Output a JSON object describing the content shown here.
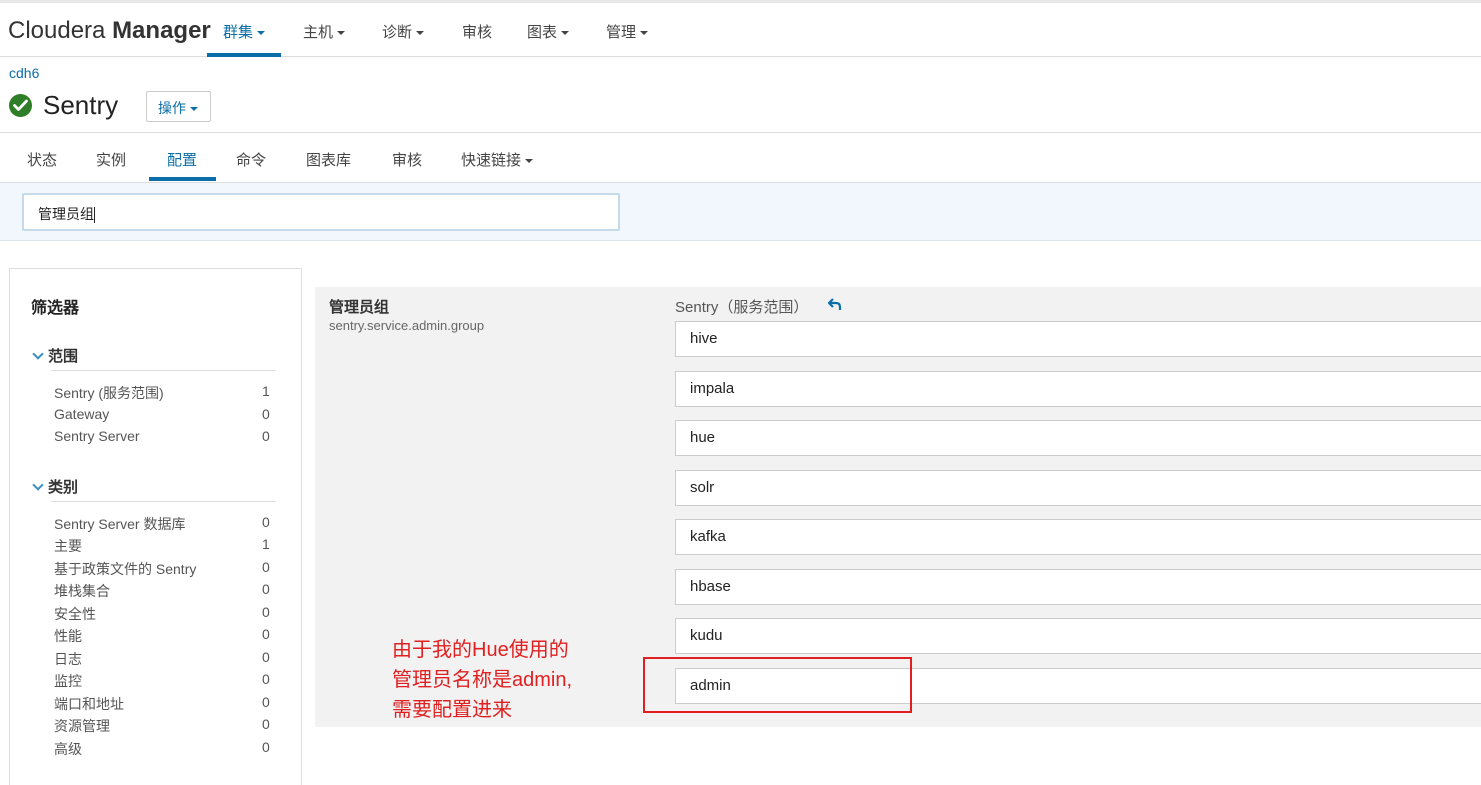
{
  "topnav": {
    "brand_light": "Cloudera ",
    "brand_bold": "Manager",
    "items": [
      {
        "label": "群集",
        "dropdown": true,
        "active": true
      },
      {
        "label": "主机",
        "dropdown": true
      },
      {
        "label": "诊断",
        "dropdown": true
      },
      {
        "label": "审核",
        "dropdown": false
      },
      {
        "label": "图表",
        "dropdown": true
      },
      {
        "label": "管理",
        "dropdown": true
      }
    ]
  },
  "header": {
    "breadcrumb": "cdh6",
    "service_name": "Sentry",
    "status": "good",
    "actions_label": "操作"
  },
  "tabs": [
    {
      "label": "状态"
    },
    {
      "label": "实例"
    },
    {
      "label": "配置",
      "active": true
    },
    {
      "label": "命令"
    },
    {
      "label": "图表库"
    },
    {
      "label": "审核"
    },
    {
      "label": "快速链接",
      "dropdown": true
    }
  ],
  "search": {
    "value": "管理员组"
  },
  "filter": {
    "title": "筛选器",
    "sections": [
      {
        "title": "范围",
        "items": [
          {
            "label": "Sentry (服务范围)",
            "count": "1"
          },
          {
            "label": "Gateway",
            "count": "0"
          },
          {
            "label": "Sentry Server",
            "count": "0"
          }
        ]
      },
      {
        "title": "类别",
        "items": [
          {
            "label": "Sentry Server 数据库",
            "count": "0"
          },
          {
            "label": "主要",
            "count": "1"
          },
          {
            "label": "基于政策文件的 Sentry",
            "count": "0"
          },
          {
            "label": "堆栈集合",
            "count": "0"
          },
          {
            "label": "安全性",
            "count": "0"
          },
          {
            "label": "性能",
            "count": "0"
          },
          {
            "label": "日志",
            "count": "0"
          },
          {
            "label": "监控",
            "count": "0"
          },
          {
            "label": "端口和地址",
            "count": "0"
          },
          {
            "label": "资源管理",
            "count": "0"
          },
          {
            "label": "高级",
            "count": "0"
          }
        ]
      }
    ]
  },
  "config": {
    "name": "管理员组",
    "key": "sentry.service.admin.group",
    "scope": "Sentry（服务范围）",
    "values": [
      "hive",
      "impala",
      "hue",
      "solr",
      "kafka",
      "hbase",
      "kudu",
      "admin"
    ]
  },
  "annotation": {
    "lines": [
      "由于我的Hue使用的",
      "管理员名称是admin,",
      "需要配置进来"
    ],
    "color": "#e02020"
  },
  "colors": {
    "accent": "#0a6ea8",
    "status_ok": "#2f7d26"
  }
}
